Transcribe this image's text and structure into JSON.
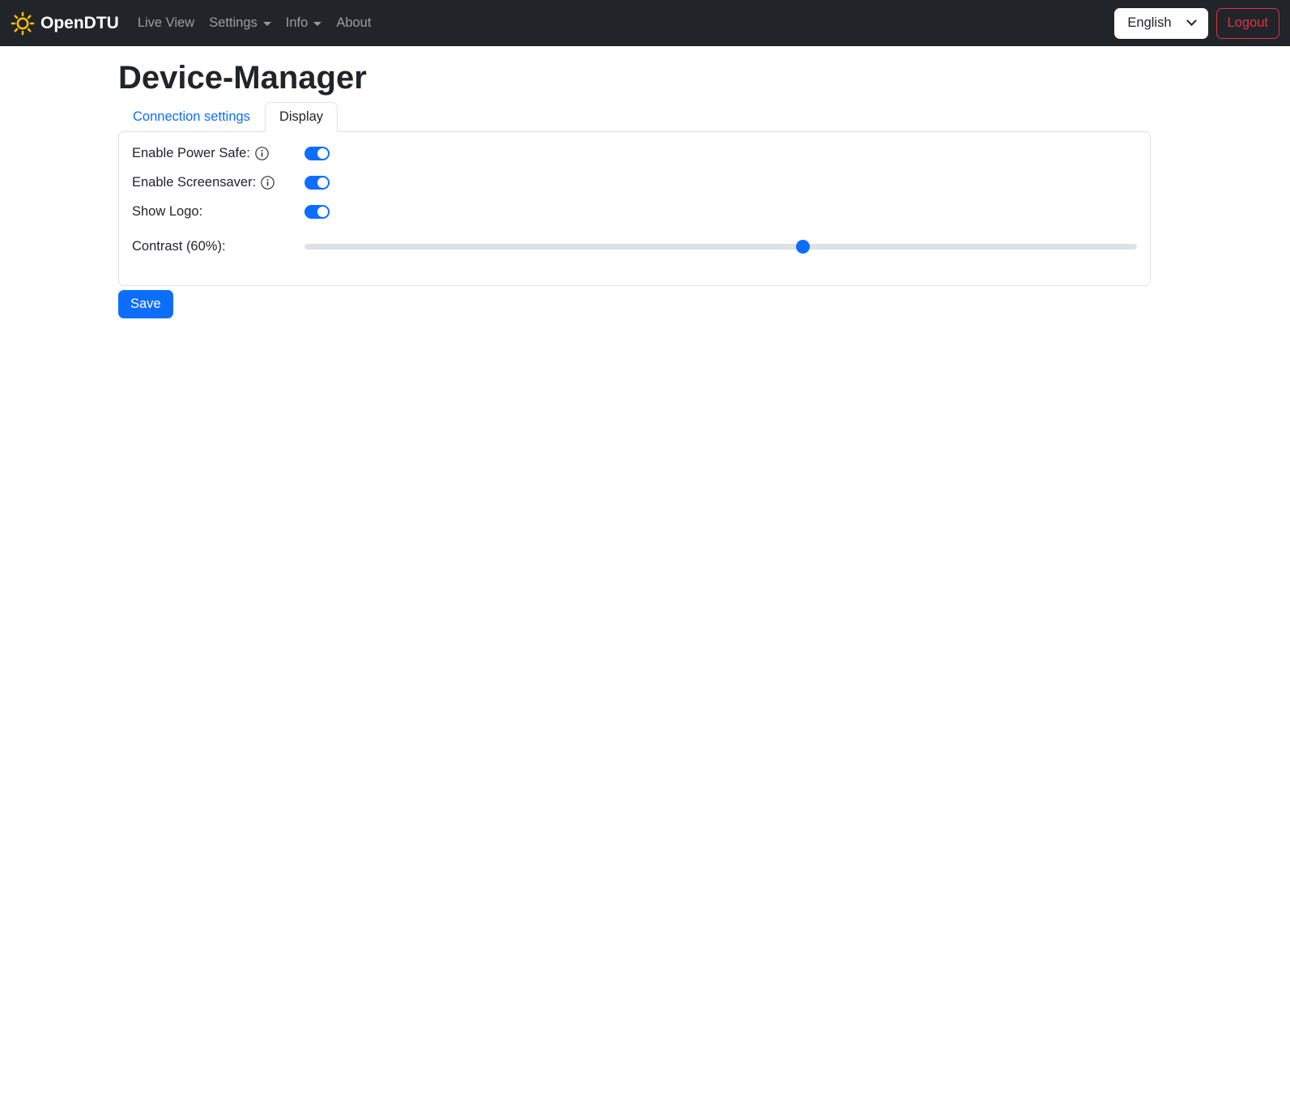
{
  "navbar": {
    "brand": "OpenDTU",
    "items": [
      {
        "label": "Live View"
      },
      {
        "label": "Settings"
      },
      {
        "label": "Info"
      },
      {
        "label": "About"
      }
    ],
    "language_selected": "English",
    "logout_label": "Logout"
  },
  "page": {
    "title": "Device-Manager",
    "tabs": [
      {
        "label": "Connection settings",
        "active": false
      },
      {
        "label": "Display",
        "active": true
      }
    ]
  },
  "settings": {
    "rows": [
      {
        "label": "Enable Power Safe:",
        "has_info": true,
        "control": "toggle",
        "value": true
      },
      {
        "label": "Enable Screensaver:",
        "has_info": true,
        "control": "toggle",
        "value": true
      },
      {
        "label": "Show Logo:",
        "has_info": false,
        "control": "toggle",
        "value": true
      },
      {
        "label": "Contrast (60%):",
        "has_info": false,
        "control": "slider",
        "value": 60,
        "min": 0,
        "max": 100
      }
    ],
    "save_label": "Save"
  },
  "colors": {
    "primary": "#0d6efd",
    "navbar_bg": "#212529",
    "brand_icon": "#ffc107",
    "danger": "#dc3545",
    "card_border": "#dee2e6"
  }
}
